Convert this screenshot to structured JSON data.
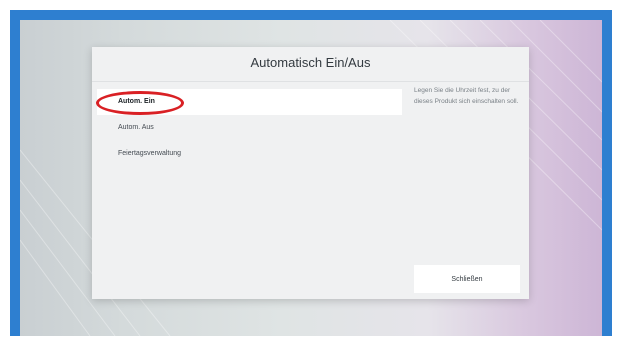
{
  "dialog": {
    "title": "Automatisch Ein/Aus",
    "menu_items": [
      {
        "label": "Autom. Ein",
        "selected": true
      },
      {
        "label": "Autom. Aus",
        "selected": false
      },
      {
        "label": "Feiertagsverwaltung",
        "selected": false
      }
    ],
    "help_text": "Legen Sie die Uhrzeit fest, zu der dieses Produkt sich einschalten soll.",
    "close_label": "Schließen"
  },
  "colors": {
    "screen_border": "#2e7fd0",
    "highlight": "#d92024",
    "selected_bg": "#ffffff",
    "dialog_bg": "#f0f1f2"
  }
}
